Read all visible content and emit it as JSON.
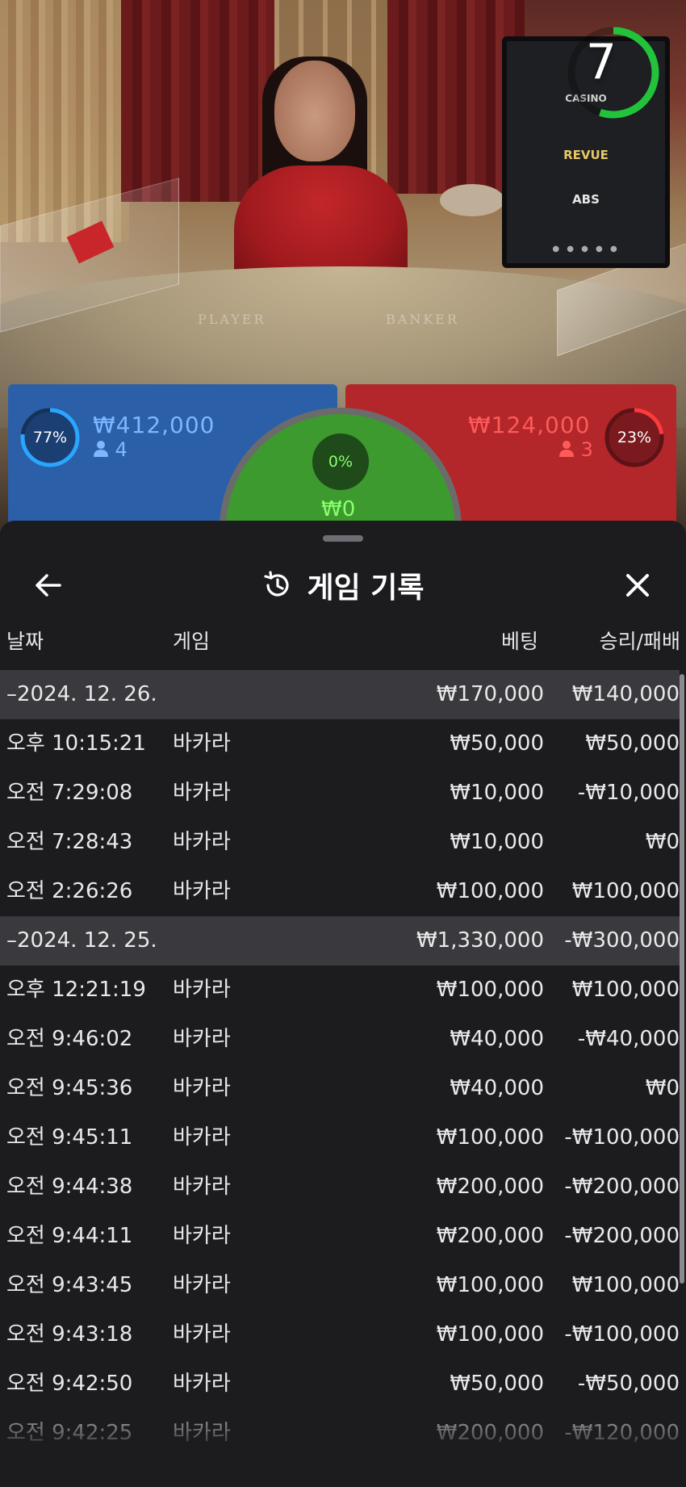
{
  "video": {
    "timer": "7",
    "table_player_text": "PLAYER",
    "table_banker_text": "BANKER",
    "monitor_items": [
      "CASINO",
      "REVUE",
      "ABS"
    ]
  },
  "betting": {
    "player": {
      "percent": "77%",
      "amount": "₩412,000",
      "count": "4"
    },
    "banker": {
      "percent": "23%",
      "amount": "₩124,000",
      "count": "3"
    },
    "tie": {
      "percent": "0%",
      "amount": "₩0"
    }
  },
  "sheet": {
    "title": "게임 기록",
    "columns": {
      "date": "날짜",
      "game": "게임",
      "bet": "베팅",
      "winloss": "승리/패배"
    },
    "rows": [
      {
        "group": true,
        "date": "–2024. 12. 26.",
        "game": "",
        "bet": "₩170,000",
        "winloss": "₩140,000"
      },
      {
        "group": false,
        "date": "오후 10:15:21",
        "game": "바카라",
        "bet": "₩50,000",
        "winloss": "₩50,000"
      },
      {
        "group": false,
        "date": "오전 7:29:08",
        "game": "바카라",
        "bet": "₩10,000",
        "winloss": "-₩10,000"
      },
      {
        "group": false,
        "date": "오전 7:28:43",
        "game": "바카라",
        "bet": "₩10,000",
        "winloss": "₩0"
      },
      {
        "group": false,
        "date": "오전 2:26:26",
        "game": "바카라",
        "bet": "₩100,000",
        "winloss": "₩100,000"
      },
      {
        "group": true,
        "date": "–2024. 12. 25.",
        "game": "",
        "bet": "₩1,330,000",
        "winloss": "-₩300,000"
      },
      {
        "group": false,
        "date": "오후 12:21:19",
        "game": "바카라",
        "bet": "₩100,000",
        "winloss": "₩100,000"
      },
      {
        "group": false,
        "date": "오전 9:46:02",
        "game": "바카라",
        "bet": "₩40,000",
        "winloss": "-₩40,000"
      },
      {
        "group": false,
        "date": "오전 9:45:36",
        "game": "바카라",
        "bet": "₩40,000",
        "winloss": "₩0"
      },
      {
        "group": false,
        "date": "오전 9:45:11",
        "game": "바카라",
        "bet": "₩100,000",
        "winloss": "-₩100,000"
      },
      {
        "group": false,
        "date": "오전 9:44:38",
        "game": "바카라",
        "bet": "₩200,000",
        "winloss": "-₩200,000"
      },
      {
        "group": false,
        "date": "오전 9:44:11",
        "game": "바카라",
        "bet": "₩200,000",
        "winloss": "-₩200,000"
      },
      {
        "group": false,
        "date": "오전 9:43:45",
        "game": "바카라",
        "bet": "₩100,000",
        "winloss": "₩100,000"
      },
      {
        "group": false,
        "date": "오전 9:43:18",
        "game": "바카라",
        "bet": "₩100,000",
        "winloss": "-₩100,000"
      },
      {
        "group": false,
        "date": "오전 9:42:50",
        "game": "바카라",
        "bet": "₩50,000",
        "winloss": "-₩50,000"
      },
      {
        "group": false,
        "date": "오전 9:42:25",
        "game": "바카라",
        "bet": "₩200,000",
        "winloss": "-₩120,000"
      }
    ]
  }
}
